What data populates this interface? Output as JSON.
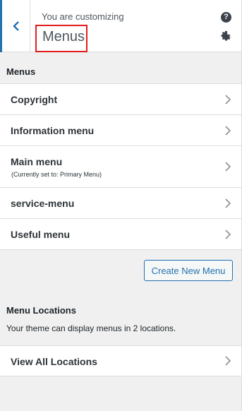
{
  "header": {
    "customizing_label": "You are customizing",
    "title": "Menus",
    "help_icon": "question-circle-icon",
    "settings_icon": "gear-icon",
    "back_icon": "chevron-left-icon",
    "highlight_color": "#e11d1d",
    "accent_color": "#2271b1"
  },
  "menus_section": {
    "title": "Menus",
    "items": [
      {
        "label": "Copyright",
        "sub": ""
      },
      {
        "label": "Information menu",
        "sub": ""
      },
      {
        "label": "Main menu",
        "sub": "(Currently set to: Primary Menu)"
      },
      {
        "label": "service-menu",
        "sub": ""
      },
      {
        "label": "Useful menu",
        "sub": ""
      }
    ],
    "create_button": "Create New Menu"
  },
  "locations_section": {
    "title": "Menu Locations",
    "description": "Your theme can display menus in 2 locations.",
    "view_all": "View All Locations"
  }
}
